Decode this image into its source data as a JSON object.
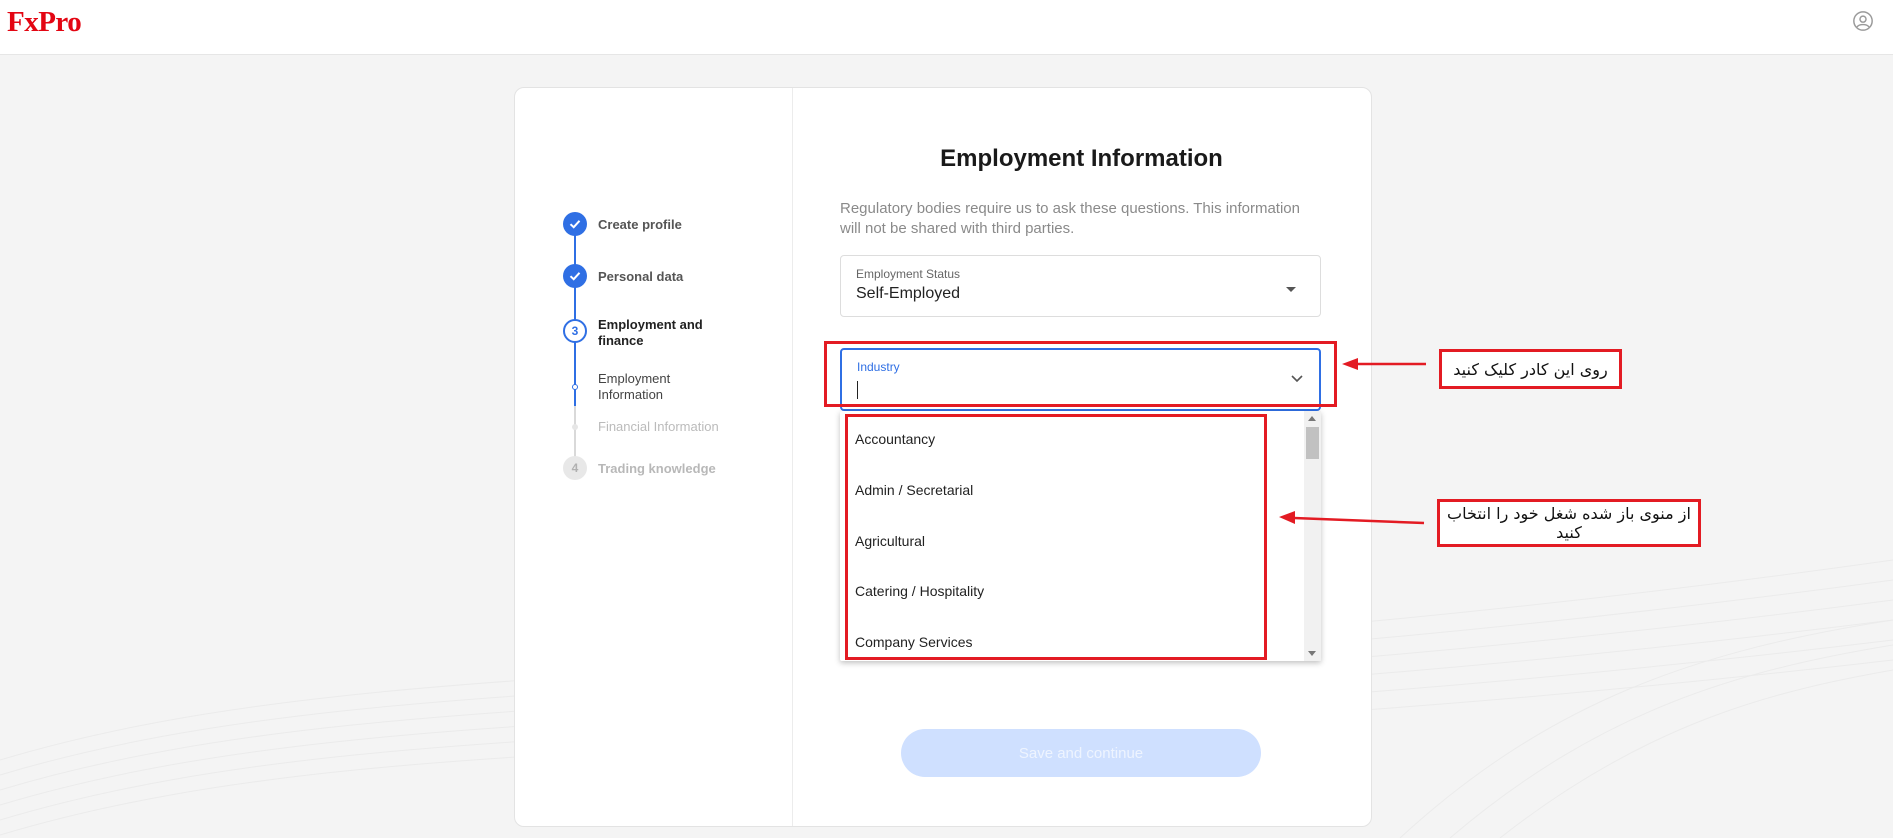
{
  "header": {
    "logo_text": "FxPro",
    "account_icon": "user-circle-icon"
  },
  "steps": [
    {
      "number": "",
      "label": "Create profile",
      "state": "done"
    },
    {
      "number": "",
      "label": "Personal data",
      "state": "done"
    },
    {
      "number": "3",
      "label": "Employment and finance",
      "state": "current"
    },
    {
      "number": "",
      "label": "Employment Information",
      "state": "sub-current"
    },
    {
      "number": "",
      "label": "Financial Information",
      "state": "sub-future"
    },
    {
      "number": "4",
      "label": "Trading knowledge",
      "state": "future"
    }
  ],
  "form": {
    "title": "Employment Information",
    "description": "Regulatory bodies require us to ask these questions. This information will not be shared with third parties.",
    "employment_status": {
      "label": "Employment Status",
      "value": "Self-Employed"
    },
    "industry": {
      "label": "Industry",
      "value": ""
    },
    "industry_options": [
      "Accountancy",
      "Admin / Secretarial",
      "Agricultural",
      "Catering / Hospitality",
      "Company Services"
    ],
    "save_label": "Save and continue"
  },
  "annotations": {
    "click_note": "روی این کادر کلیک کنید",
    "select_note": "از منوی باز شده شغل خود را انتخاب کنید"
  },
  "colors": {
    "brand": "#e30613",
    "accent": "#2f6fe4",
    "annotation": "#e31b23"
  }
}
